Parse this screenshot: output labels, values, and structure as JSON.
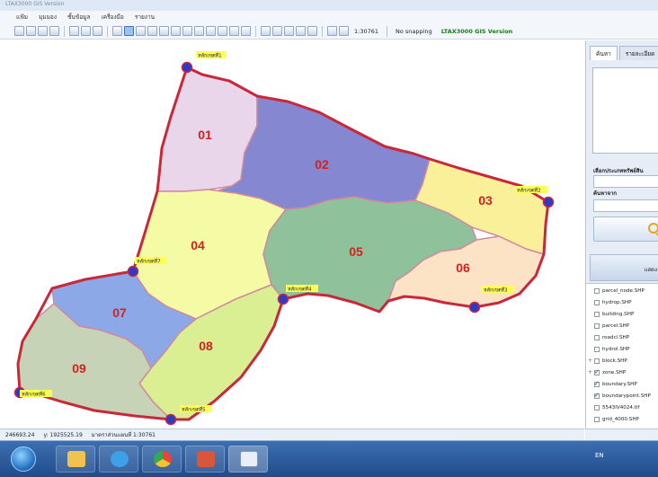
{
  "window": {
    "title": "LTAX3000 GIS Version"
  },
  "menu": [
    "แฟ้ม",
    "มุมมอง",
    "ชั้นข้อมูล",
    "เครื่องมือ",
    "รายงาน"
  ],
  "toolbar": {
    "scale": "1:30761",
    "snapping": "No snapping",
    "version": "LTAX3000 GIS Version"
  },
  "colors": {
    "boundary": "#c8283a",
    "marker_fill": "#2f38c9",
    "zone_label": "#d42020",
    "point_label_bg": "#ffff55"
  },
  "map": {
    "zones": [
      {
        "id": "01",
        "fill": "#ead6ea"
      },
      {
        "id": "02",
        "fill": "#8587d1"
      },
      {
        "id": "03",
        "fill": "#fbf09a"
      },
      {
        "id": "04",
        "fill": "#f5fba5"
      },
      {
        "id": "05",
        "fill": "#8fc29a"
      },
      {
        "id": "06",
        "fill": "#fde3c6"
      },
      {
        "id": "07",
        "fill": "#8da8e6"
      },
      {
        "id": "08",
        "fill": "#d9ef92"
      },
      {
        "id": "09",
        "fill": "#c6d3b7"
      }
    ],
    "points": [
      {
        "label": "หลักเขตที่1"
      },
      {
        "label": "หลักเขตที่2"
      },
      {
        "label": "หลักเขตที่3"
      },
      {
        "label": "หลักเขตที่4"
      },
      {
        "label": "หลักเขตที่5"
      },
      {
        "label": "หลักเขตที่6"
      },
      {
        "label": "หลักเขตที่7"
      }
    ]
  },
  "side": {
    "tabs": [
      "ค้นหา",
      "รายละเอียด"
    ],
    "type_label": "เลือกประเภททรัพย์สิน",
    "search_from_label": "ค้นหาจาก",
    "run_button": "แสดง"
  },
  "layers": [
    {
      "name": "parcel_node.SHP",
      "checked": false,
      "expandable": false
    },
    {
      "name": "hydrop.SHP",
      "checked": false,
      "expandable": false
    },
    {
      "name": "building.SHP",
      "checked": false,
      "expandable": false
    },
    {
      "name": "parcel.SHP",
      "checked": false,
      "expandable": false
    },
    {
      "name": "roadcl.SHP",
      "checked": false,
      "expandable": false
    },
    {
      "name": "hydrol.SHP",
      "checked": false,
      "expandable": false
    },
    {
      "name": "block.SHP",
      "checked": false,
      "expandable": true
    },
    {
      "name": "zone.SHP",
      "checked": true,
      "expandable": true
    },
    {
      "name": "boundary.SHP",
      "checked": true,
      "expandable": false
    },
    {
      "name": "boundarypoint.SHP",
      "checked": true,
      "expandable": false
    },
    {
      "name": "5543IV4024.tif",
      "checked": false,
      "expandable": false
    },
    {
      "name": "grid_4000.SHP",
      "checked": false,
      "expandable": false
    }
  ],
  "status": {
    "x": "246693.24",
    "y": "y: 1925525.19",
    "scale_text": "มาตราส่วนแผนที่ 1:30761"
  },
  "taskbar": {
    "tray_lang": "EN"
  }
}
